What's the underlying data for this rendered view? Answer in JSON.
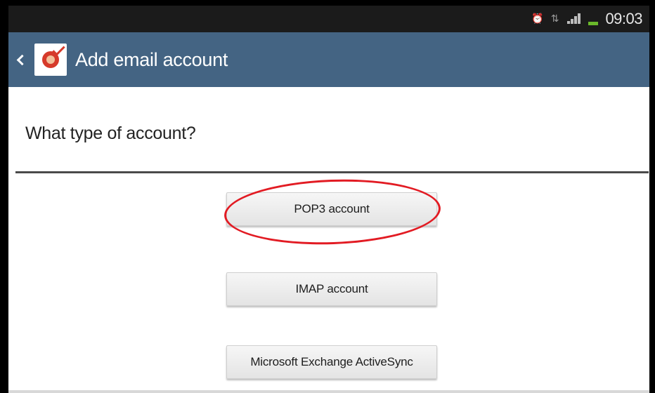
{
  "status_bar": {
    "time": "09:03",
    "icons": [
      "alarm-icon",
      "network-type-icon",
      "signal-icon",
      "battery-icon"
    ]
  },
  "action_bar": {
    "title": "Add email account",
    "back_icon": "chevron-left-icon",
    "app_icon": "email-app-icon",
    "color": "#446483"
  },
  "main": {
    "heading": "What type of account?",
    "options": [
      {
        "label": "POP3 account",
        "highlighted": true
      },
      {
        "label": "IMAP account",
        "highlighted": false
      },
      {
        "label": "Microsoft Exchange ActiveSync",
        "highlighted": false
      }
    ]
  },
  "annotation": {
    "highlight_color": "#e21b23"
  }
}
